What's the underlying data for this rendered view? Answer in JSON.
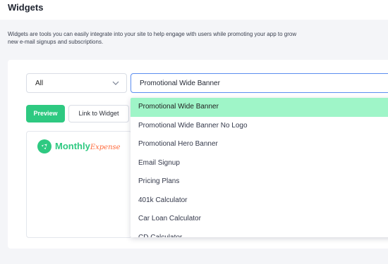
{
  "page": {
    "title": "Widgets"
  },
  "description": "Widgets are tools you can easily integrate into your site to help engage with users while promoting your app to grow new e-mail signups and subscriptions.",
  "filters": {
    "category": {
      "value": "All",
      "icon": "chevron-down-icon"
    },
    "widget": {
      "value": "Promotional Wide Banner"
    }
  },
  "actions": {
    "preview": "Preview",
    "link": "Link to Widget"
  },
  "preview": {
    "logo_main": "Monthly",
    "logo_accent": "Expense",
    "logo_icon": "dollar-leaf-icon"
  },
  "dropdown": {
    "options": [
      "Promotional Wide Banner",
      "Promotional Wide Banner No Logo",
      "Promotional Hero Banner",
      "Email Signup",
      "Pricing Plans",
      "401k Calculator",
      "Car Loan Calculator",
      "CD Calculator"
    ],
    "selected_index": 0
  },
  "colors": {
    "brand_green": "#2ec981",
    "highlight": "#9ff5c8",
    "accent_orange": "#ff6b3d",
    "focus_blue": "#5b8def"
  }
}
